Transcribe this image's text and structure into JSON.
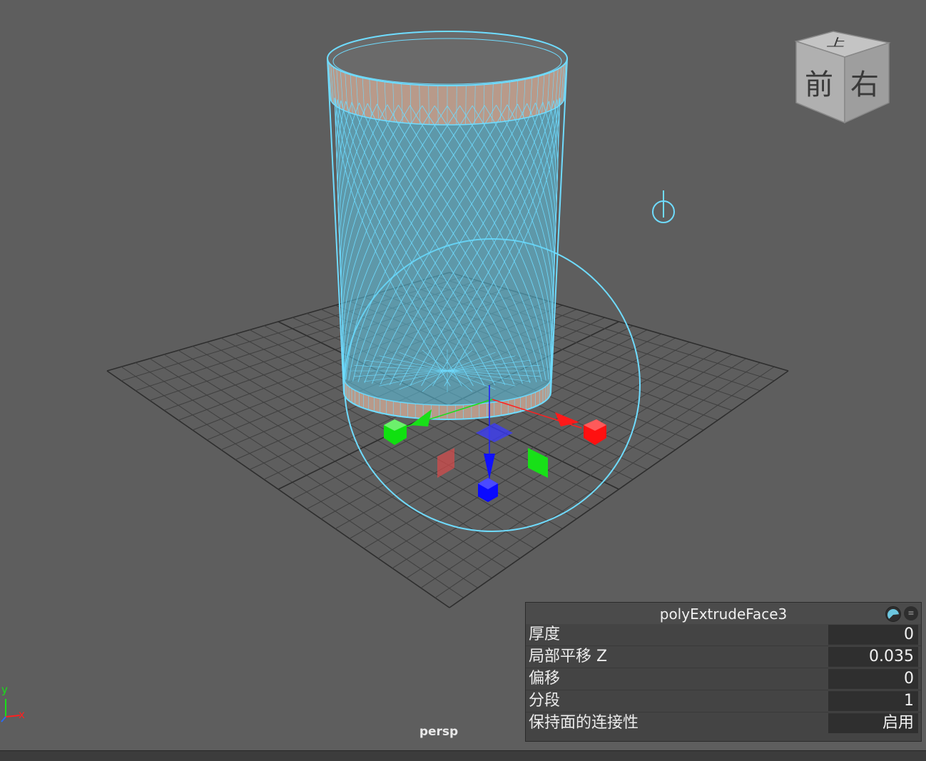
{
  "viewport": {
    "camera_label": "persp",
    "axis_indicator": {
      "y_label": "y",
      "x_label": "x"
    }
  },
  "view_cube": {
    "top_face": "上",
    "front_face": "前",
    "right_face": "右"
  },
  "channel_box": {
    "title": "polyExtrudeFace3",
    "icon_pie": "pie-chart-icon",
    "icon_menu": "menu-icon",
    "rows": [
      {
        "label": "厚度",
        "value": "0"
      },
      {
        "label": "局部平移 Z",
        "value": "0.035"
      },
      {
        "label": "偏移",
        "value": "0"
      },
      {
        "label": "分段",
        "value": "1"
      },
      {
        "label": "保持面的连接性",
        "value": "启用"
      }
    ]
  },
  "colors": {
    "background": "#5e5e5e",
    "wireframe": "#6fdcff",
    "x_axis": "#ff2020",
    "y_axis": "#18e018",
    "z_axis": "#1010ff"
  }
}
